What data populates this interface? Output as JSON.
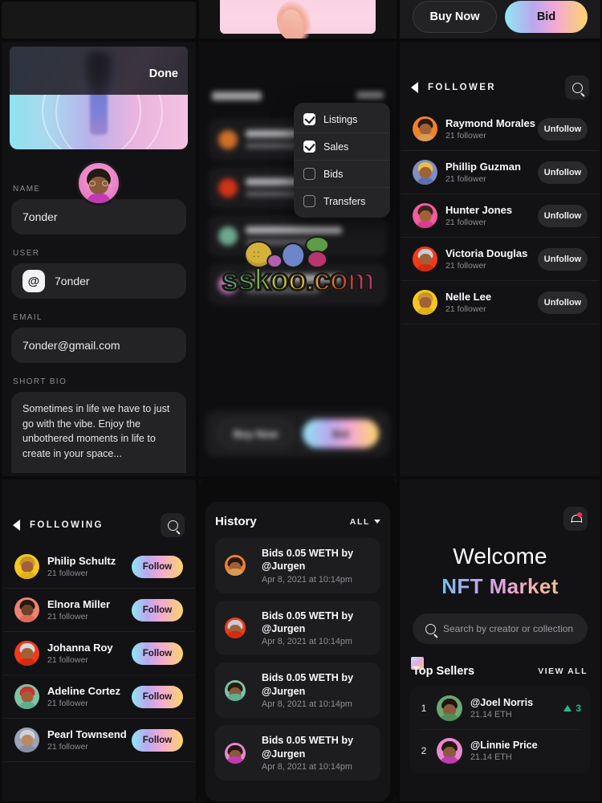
{
  "top_strip": {
    "buy_now_label": "Buy Now",
    "bid_label": "Bid"
  },
  "profile_edit": {
    "done_label": "Done",
    "name_label": "NAME",
    "name_value": "7onder",
    "user_label": "USER",
    "user_value": "7onder",
    "user_prefix_icon": "at-icon",
    "email_label": "EMAIL",
    "email_value": "7onder@gmail.com",
    "bio_label": "SHORT BIO",
    "bio_value": "Sometimes in life we have to just go with the vibe. Enjoy the unbothered moments in life to create in your space..."
  },
  "filter_menu": {
    "items": [
      {
        "label": "Listings",
        "checked": true
      },
      {
        "label": "Sales",
        "checked": true
      },
      {
        "label": "Bids",
        "checked": false
      },
      {
        "label": "Transfers",
        "checked": false
      }
    ],
    "bottom_buy_label": "Buy Now",
    "bottom_bid_label": "Bid",
    "watermark": "sskoo.com"
  },
  "follower_panel": {
    "back_icon": "back-triangle-icon",
    "title": "FOLLOWER",
    "search_icon": "search-icon",
    "action_label": "Unfollow",
    "users": [
      {
        "name": "Raymond Morales",
        "sub": "21 follower",
        "av_bg": "#f0802c",
        "hair": "#2a1a10",
        "face": "#a06138",
        "body": "#d99a56"
      },
      {
        "name": "Phillip Guzman",
        "sub": "21 follower",
        "av_bg": "#7e8fc0",
        "hair": "#e3be52",
        "face": "#a06138",
        "body": "#5d6fa8"
      },
      {
        "name": "Hunter Jones",
        "sub": "21 follower",
        "av_bg": "#f25ba0",
        "hair": "#3a2318",
        "face": "#a06138",
        "body": "#d83c8a"
      },
      {
        "name": "Victoria Douglas",
        "sub": "21 follower",
        "av_bg": "#f23a18",
        "hair": "#c9cdd6",
        "face": "#a06138",
        "body": "#d02c12"
      },
      {
        "name": "Nelle Lee",
        "sub": "21 follower",
        "av_bg": "#f6c71f",
        "hair": "#c8942e",
        "face": "#a06138",
        "body": "#e0b018"
      }
    ]
  },
  "following_panel": {
    "back_icon": "back-triangle-icon",
    "title": "FOLLOWING",
    "search_icon": "search-icon",
    "action_label": "Follow",
    "users": [
      {
        "name": "Philip Schultz",
        "sub": "21 follower",
        "av_bg": "#f6c71f",
        "hair": "#c8942e",
        "face": "#a06138",
        "body": "#e0b018"
      },
      {
        "name": "Elnora Miller",
        "sub": "21 follower",
        "av_bg": "#ef8272",
        "hair": "#241710",
        "face": "#6e4327",
        "body": "#dd6a5a"
      },
      {
        "name": "Johanna Roy",
        "sub": "21 follower",
        "av_bg": "#f23a18",
        "hair": "#d7d9de",
        "face": "#a06138",
        "body": "#d02c12"
      },
      {
        "name": "Adeline Cortez",
        "sub": "21 follower",
        "av_bg": "#7dc3a6",
        "hair": "#cf3030",
        "face": "#a06138",
        "body": "#5fae8e"
      },
      {
        "name": "Pearl Townsend",
        "sub": "21 follower",
        "av_bg": "#9ba3b8",
        "hair": "#cfd2d8",
        "face": "#b88a64",
        "body": "#868ea4"
      }
    ]
  },
  "history_panel": {
    "title": "History",
    "filter_label": "ALL",
    "filter_caret_icon": "chevron-down-icon",
    "rows": [
      {
        "text": "Bids 0.05 WETH by @Jurgen",
        "time": "Apr 8, 2021 at 10:14pm",
        "av_bg": "#f0802c",
        "hair": "#2a1a10",
        "face": "#a06138",
        "body": "#d99a56"
      },
      {
        "text": "Bids 0.05 WETH by @Jurgen",
        "time": "Apr 8, 2021 at 10:14pm",
        "av_bg": "#f23a18",
        "hair": "#c9cdd6",
        "face": "#a06138",
        "body": "#d02c12"
      },
      {
        "text": "Bids 0.05 WETH by @Jurgen",
        "time": "Apr 8, 2021 at 10:14pm",
        "av_bg": "#7dc3a6",
        "hair": "#2a1a10",
        "face": "#8a5a3c",
        "body": "#5fae8e"
      },
      {
        "text": "Bids 0.05 WETH by @Jurgen",
        "time": "Apr 8, 2021 at 10:14pm",
        "av_bg": "#e887d2",
        "hair": "#241710",
        "face": "#8a5a3c",
        "body": "#c13bb0"
      }
    ]
  },
  "welcome_panel": {
    "bell_icon": "bell-icon",
    "notification_dot_color": "#ff2d55",
    "welcome_title": "Welcome",
    "brand_title": "NFT Market",
    "search_icon": "search-icon",
    "search_placeholder": "Search by creator or collection",
    "top_sellers_title": "Top Sellers",
    "view_all_label": "VIEW ALL",
    "sellers": [
      {
        "rank": "1",
        "name": "@Joel Norris",
        "eth": "21.14 ETH",
        "delta": "3",
        "delta_icon": "triangle-up-icon",
        "av_bg": "#6aa86f",
        "hair": "#1d1410",
        "face": "#8a5a3c",
        "body": "#4f8f57"
      },
      {
        "rank": "2",
        "name": "@Linnie Price",
        "eth": "21.14 ETH",
        "delta": "",
        "delta_icon": "",
        "av_bg": "#e887d2",
        "hair": "#241710",
        "face": "#8a5a3c",
        "body": "#c13bb0"
      }
    ]
  }
}
